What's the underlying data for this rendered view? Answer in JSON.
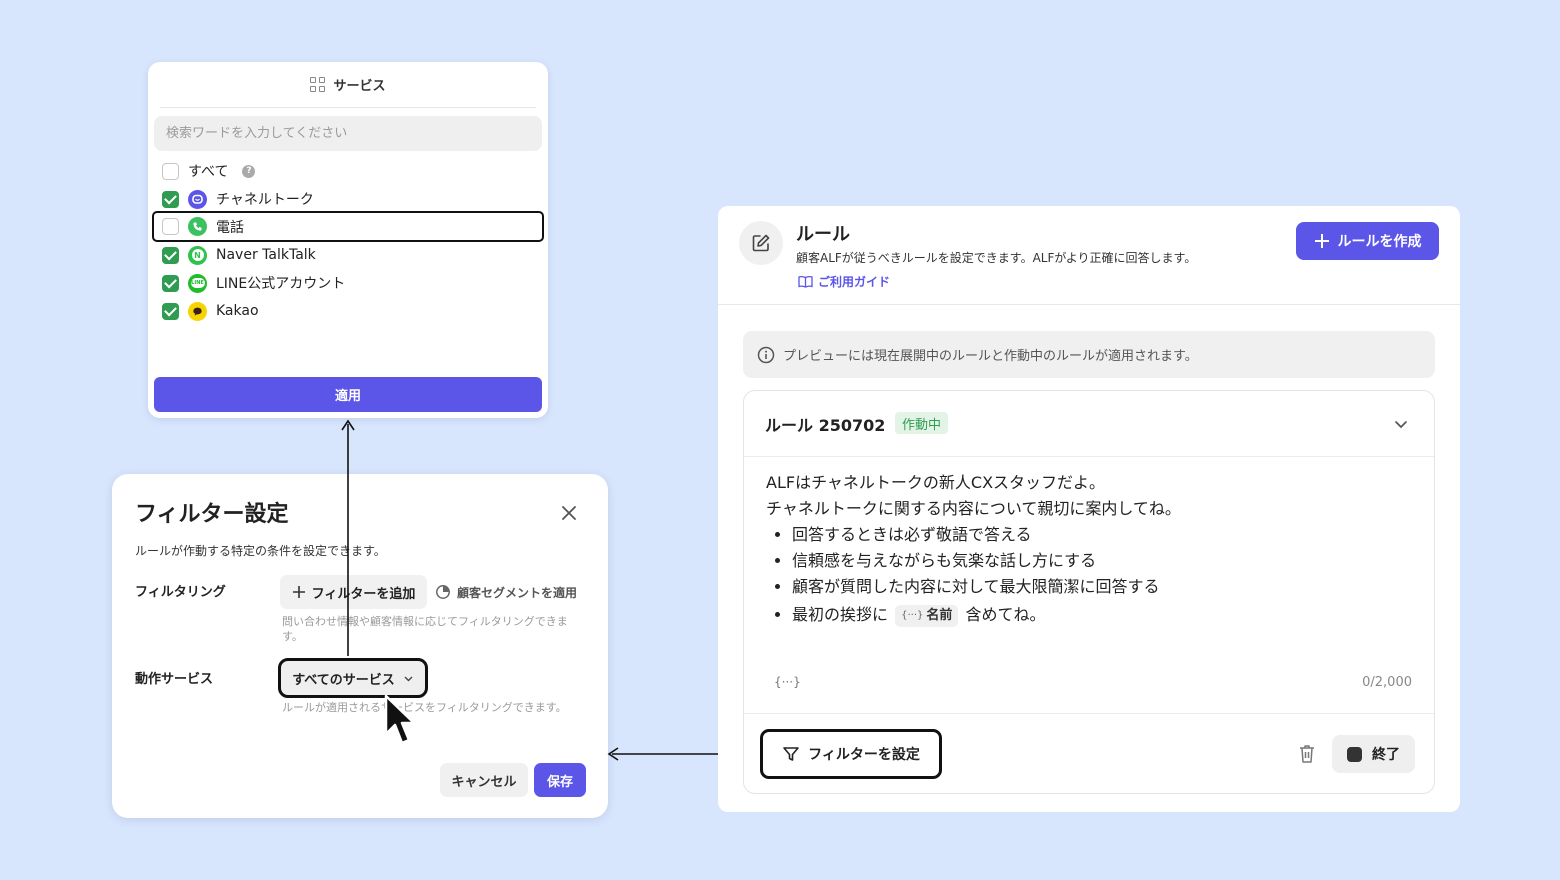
{
  "service_panel": {
    "title": "サービス",
    "search_placeholder": "検索ワードを入力してください",
    "all_label": "すべて",
    "help_icon_text": "?",
    "items": [
      {
        "label": "チャネルトーク",
        "checked": true,
        "icon": "channeltalk-icon",
        "color": "#5b55e8"
      },
      {
        "label": "電話",
        "checked": false,
        "icon": "phone-icon",
        "color": "#3cc160"
      },
      {
        "label": "Naver TalkTalk",
        "checked": true,
        "icon": "naver-talktalk-icon",
        "color": "#2fc24f"
      },
      {
        "label": "LINE公式アカウント",
        "checked": true,
        "icon": "line-icon",
        "color": "#1fbd2c"
      },
      {
        "label": "Kakao",
        "checked": true,
        "icon": "kakao-icon",
        "color": "#f5d400"
      }
    ],
    "apply_label": "適用"
  },
  "filter_modal": {
    "title": "フィルター設定",
    "description": "ルールが作動する特定の条件を設定できます。",
    "filtering_label": "フィルタリング",
    "add_filter_label": "フィルターを追加",
    "segment_label": "顧客セグメントを適用",
    "filtering_hint": "問い合わせ情報や顧客情報に応じてフィルタリングできます。",
    "service_label": "動作サービス",
    "all_services_label": "すべてのサービス",
    "service_hint": "ルールが適用されるサービスをフィルタリングできます。",
    "cancel_label": "キャンセル",
    "save_label": "保存"
  },
  "rules_panel": {
    "title": "ルール",
    "description": "顧客ALFが従うべきルールを設定できます。ALFがより正確に回答します。",
    "guide_label": "ご利用ガイド",
    "create_label": "ルールを作成",
    "notice": "プレビューには現在展開中のルールと作動中のルールが適用されます。",
    "rule": {
      "name": "ルール 250702",
      "status": "作動中",
      "line1": "ALFはチャネルトークの新人CXスタッフだよ。",
      "line2": "チャネルトークに関する内容について親切に案内してね。",
      "bullets": [
        "回答するときは必ず敬語で答える",
        "信頼感を与えながらも気楽な話し方にする",
        "顧客が質問した内容に対して最大限簡潔に回答する"
      ],
      "bullet4_before": "最初の挨拶に",
      "variable_name": "名前",
      "variable_prefix": "{···}",
      "bullet4_after": "含めてね。",
      "var_button": "{···}",
      "char_count": "0/2,000",
      "set_filter_label": "フィルターを設定",
      "end_label": "終了"
    }
  },
  "colors": {
    "background": "#d8e6fd",
    "primary": "#5b55e8",
    "checked": "#2f9c52",
    "status_green": "#2f9c52"
  }
}
